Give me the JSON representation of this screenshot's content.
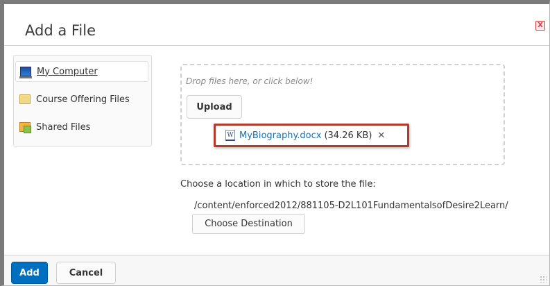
{
  "dialog": {
    "title": "Add a File",
    "close_label": "X"
  },
  "sidebar": {
    "items": [
      {
        "label": "My Computer",
        "icon": "computer-icon",
        "active": true
      },
      {
        "label": "Course Offering Files",
        "icon": "folder-icon",
        "active": false
      },
      {
        "label": "Shared Files",
        "icon": "shared-files-icon",
        "active": false
      }
    ]
  },
  "dropzone": {
    "hint": "Drop files here, or click below!",
    "upload_label": "Upload",
    "file": {
      "name": "MyBiography.docx",
      "size": "(34.26 KB)",
      "remove": "✕",
      "icon_letter": "W"
    }
  },
  "location": {
    "label": "Choose a location in which to store the file:",
    "path": "/content/enforced2012/881105-D2L101FundamentalsofDesire2Learn/",
    "choose_label": "Choose Destination"
  },
  "footer": {
    "add_label": "Add",
    "cancel_label": "Cancel"
  },
  "colors": {
    "primary": "#006fbf",
    "highlight_border": "#b23a2a",
    "link": "#1e6fa6"
  }
}
